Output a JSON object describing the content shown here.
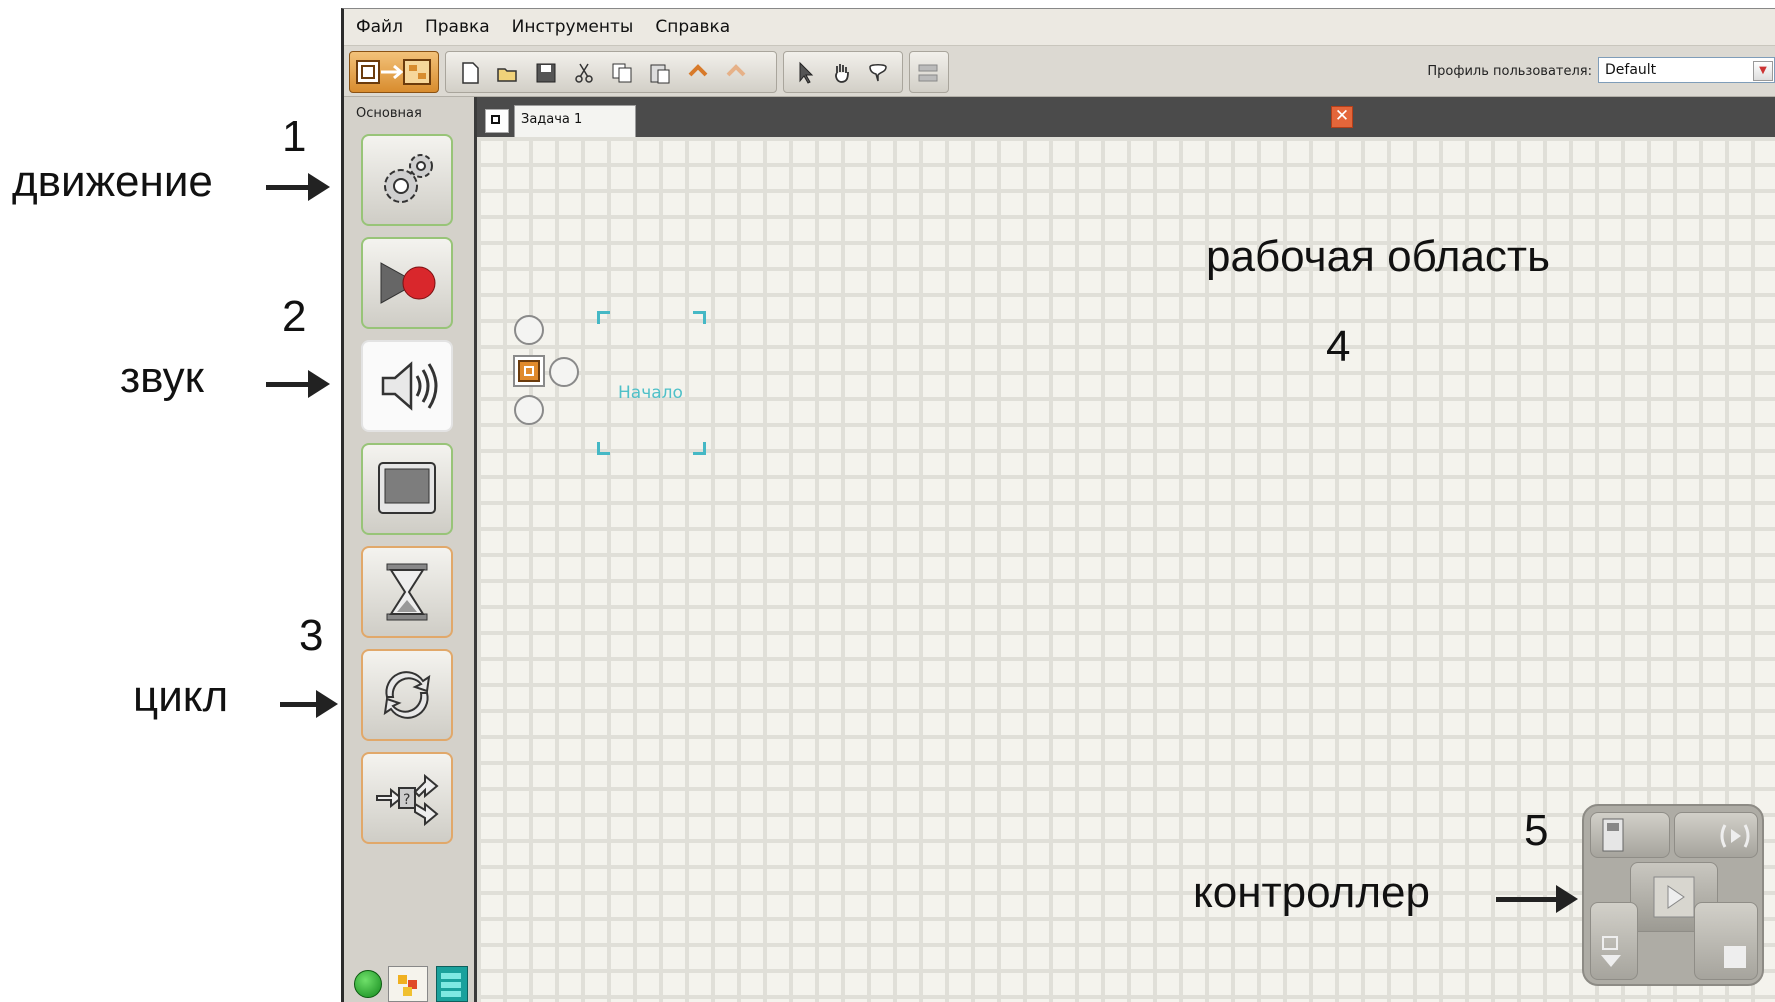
{
  "annotations": {
    "n1": "1",
    "motion": "движение",
    "n2": "2",
    "sound": "звук",
    "n3": "3",
    "loop": "цикл",
    "workspace": "рабочая область",
    "n4": "4",
    "n5": "5",
    "controller": "контроллер"
  },
  "menu": [
    "Файл",
    "Правка",
    "Инструменты",
    "Справка"
  ],
  "toolbar": {
    "icons": [
      "mode-switch-icon",
      "new-file-icon",
      "open-icon",
      "save-icon",
      "cut-icon",
      "copy-icon",
      "paste-icon",
      "undo-icon",
      "redo-icon",
      "pointer-icon",
      "hand-icon",
      "comment-icon",
      "config-icon"
    ],
    "profile_label": "Профиль пользователя:",
    "profile_value": "Default"
  },
  "palette": {
    "tab_label": "Основная",
    "blocks": [
      "motion-gears-icon",
      "record-play-icon",
      "sound-icon",
      "display-icon",
      "wait-hourglass-icon",
      "loop-icon",
      "switch-icon"
    ],
    "bottom_tabs": [
      "common-palette-tab",
      "complete-palette-tab",
      "custom-palette-tab"
    ]
  },
  "tabs": [
    {
      "label": "Задача 1"
    }
  ],
  "canvas": {
    "start_label": "Начало"
  },
  "controller_buttons": [
    "nxt-window-icon",
    "download-run-selected-icon",
    "download-run-icon",
    "download-icon",
    "stop-icon"
  ]
}
